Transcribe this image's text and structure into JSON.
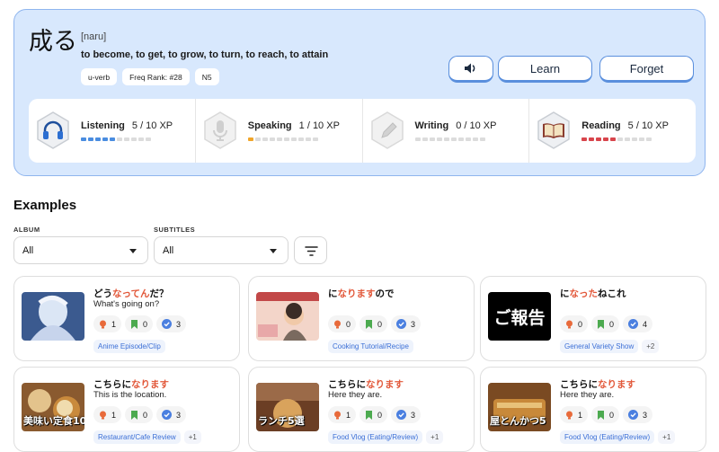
{
  "word": {
    "kanji": "成る",
    "reading": "[naru]",
    "meaning": "to become, to get, to grow, to turn, to reach, to attain",
    "tags": [
      "u-verb",
      "Freq Rank: #28",
      "N5"
    ],
    "buttons": {
      "learn": "Learn",
      "forget": "Forget"
    }
  },
  "skills": [
    {
      "name": "Listening",
      "xp": "5 / 10 XP",
      "level": 5,
      "color": "#4a8de0",
      "icon": "headphones-icon"
    },
    {
      "name": "Speaking",
      "xp": "1 / 10 XP",
      "level": 1,
      "color": "#f0a52a",
      "icon": "microphone-icon"
    },
    {
      "name": "Writing",
      "xp": "0 / 10 XP",
      "level": 0,
      "color": "#9b9b9b",
      "icon": "pen-icon"
    },
    {
      "name": "Reading",
      "xp": "5 / 10 XP",
      "level": 5,
      "color": "#d8454c",
      "icon": "book-icon"
    }
  ],
  "examples": {
    "title": "Examples",
    "filters": {
      "album_label": "ALBUM",
      "album_value": "All",
      "subtitles_label": "SUBTITLES",
      "subtitles_value": "All"
    },
    "cards": [
      {
        "jp_pre": "どう",
        "jp_hl": "なってん",
        "jp_post": "だ？",
        "en": "What's going on?",
        "stats": [
          "1",
          "0",
          "3"
        ],
        "chips": [
          "Anime Episode/Clip"
        ],
        "more": "",
        "thumb": "anime",
        "thumb_text": ""
      },
      {
        "jp_pre": "に",
        "jp_hl": "なります",
        "jp_post": "ので",
        "en": "",
        "stats": [
          "0",
          "0",
          "3"
        ],
        "chips": [
          "Cooking Tutorial/Recipe"
        ],
        "more": "",
        "thumb": "cooking",
        "thumb_text": ""
      },
      {
        "jp_pre": "に",
        "jp_hl": "なった",
        "jp_post": "ねこれ",
        "en": "",
        "stats": [
          "0",
          "0",
          "4"
        ],
        "chips": [
          "General Variety Show"
        ],
        "more": "+2",
        "thumb": "report",
        "thumb_text": "ご報告"
      },
      {
        "jp_pre": "こちらに",
        "jp_hl": "なります",
        "jp_post": "",
        "en": "This is the location.",
        "stats": [
          "1",
          "0",
          "3"
        ],
        "chips": [
          "Restaurant/Cafe Review"
        ],
        "more": "+1",
        "thumb": "food1",
        "thumb_text": "美味い定食10"
      },
      {
        "jp_pre": "こちらに",
        "jp_hl": "なります",
        "jp_post": "",
        "en": "Here they are.",
        "stats": [
          "1",
          "0",
          "3"
        ],
        "chips": [
          "Food Vlog (Eating/Review)"
        ],
        "more": "+1",
        "thumb": "food2",
        "thumb_text": "ランチ5選"
      },
      {
        "jp_pre": "こちらに",
        "jp_hl": "なります",
        "jp_post": "",
        "en": "Here they are.",
        "stats": [
          "1",
          "0",
          "3"
        ],
        "chips": [
          "Food Vlog (Eating/Review)"
        ],
        "more": "+1",
        "thumb": "food3",
        "thumb_text": "屋とんかつ5"
      }
    ]
  }
}
